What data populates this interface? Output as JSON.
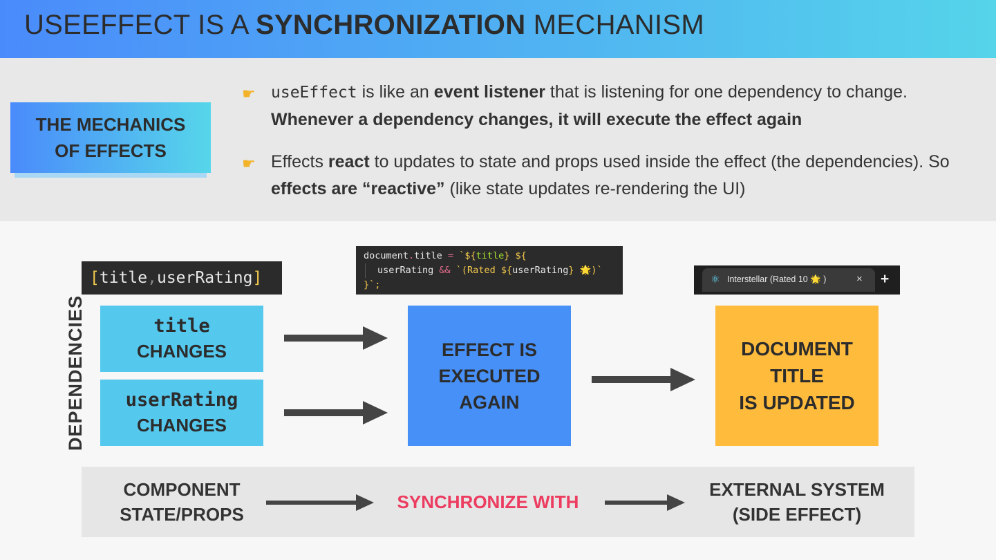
{
  "header": {
    "title_normal1": "USEEFFECT IS A ",
    "title_bold": "SYNCHRONIZATION",
    "title_normal2": " MECHANISM"
  },
  "mechanics_box": {
    "line1": "THE MECHANICS",
    "line2": "OF EFFECTS"
  },
  "bullet1": {
    "code": "useEffect",
    "t1": " is like an ",
    "b1": "event listener",
    "t2": " that is listening for one dependency to change. ",
    "b2": "Whenever a dependency changes, it will execute the effect again"
  },
  "bullet2": {
    "t1": "Effects ",
    "b1": "react",
    "t2": " to updates to state and props used inside the effect (the dependencies). So ",
    "b2": "effects are “reactive”",
    "t3": " (like state updates re-rendering the UI)"
  },
  "dependency_array": {
    "open": "[",
    "title": "title",
    "comma": ", ",
    "rating": "userRating",
    "close": "]"
  },
  "effect_code": {
    "l1_a": "document",
    "l1_b": ".",
    "l1_c": "title",
    "l1_d": " = ",
    "l1_e": "`${",
    "l1_f": "title",
    "l1_g": "} ${",
    "l2_a": "userRating",
    "l2_b": " && ",
    "l2_c": "`(Rated ${",
    "l2_d": "userRating",
    "l2_e": "} 🌟)`",
    "l3_a": "}",
    "l3_b": "`;"
  },
  "browser_tab": {
    "icon": "⚛",
    "title": "Interstellar (Rated 10 🌟 )",
    "close": "×",
    "plus": "+"
  },
  "dependencies_label": "DEPENDENCIES",
  "title_change": {
    "code": "title",
    "label": "CHANGES"
  },
  "rating_change": {
    "code": "userRating",
    "label": "CHANGES"
  },
  "effect_box": {
    "l1": "EFFECT IS",
    "l2": "EXECUTED",
    "l3": "AGAIN"
  },
  "document_box": {
    "l1": "DOCUMENT",
    "l2": "TITLE",
    "l3": "IS UPDATED"
  },
  "bottom_row": {
    "left1": "COMPONENT",
    "left2": "STATE/PROPS",
    "mid": "SYNCHRONIZE WITH",
    "right1": "EXTERNAL SYSTEM",
    "right2": "(SIDE EFFECT)"
  },
  "colors": {
    "header_gradient_start": "#4a8bfb",
    "header_gradient_end": "#55d4ea",
    "cyan_box": "#55c8ee",
    "effect_box": "#4690f7",
    "document_box": "#ffbb3c",
    "synchronize_text": "#ec3c5f",
    "arrow": "#444444"
  }
}
